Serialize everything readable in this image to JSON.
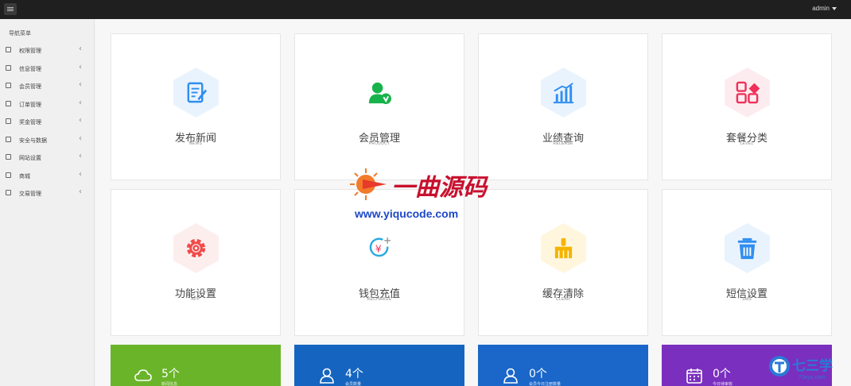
{
  "topbar": {
    "user": "admin"
  },
  "sidebar": {
    "title": "导航菜单",
    "items": [
      {
        "label": "权限管理",
        "icon": "key-icon"
      },
      {
        "label": "信息管理",
        "icon": "key-icon"
      },
      {
        "label": "会员管理",
        "icon": "user-icon"
      },
      {
        "label": "订单管理",
        "icon": "order-icon"
      },
      {
        "label": "奖金管理",
        "icon": "monitor-icon"
      },
      {
        "label": "安全与数据",
        "icon": "monitor-icon"
      },
      {
        "label": "网站设置",
        "icon": "monitor-icon"
      },
      {
        "label": "商城",
        "icon": "shop-icon"
      },
      {
        "label": "交易管理",
        "icon": "grid-icon"
      }
    ]
  },
  "cards": [
    {
      "title": "发布新闻",
      "sub": "NEWS",
      "color": "#2f8ef0",
      "bg": "#e9f3fe",
      "icon": "edit-icon"
    },
    {
      "title": "会员管理",
      "sub": "PRODUCT",
      "color": "#17b34a",
      "bg": "#ffffff",
      "icon": "member-icon"
    },
    {
      "title": "业绩查询",
      "sub": "RELEASE",
      "color": "#2f8ef0",
      "bg": "#e9f3fe",
      "icon": "chart-icon"
    },
    {
      "title": "套餐分类",
      "sub": "LEVEL",
      "color": "#f0305a",
      "bg": "#fdecef",
      "icon": "category-icon"
    },
    {
      "title": "功能设置",
      "sub": "APP",
      "color": "#f04a4a",
      "bg": "#fdeeee",
      "icon": "gear-icon"
    },
    {
      "title": "钱包充值",
      "sub": "RECHARGE",
      "color": "#f0305a",
      "bg": "#ffffff",
      "icon": "wallet-icon"
    },
    {
      "title": "缓存清除",
      "sub": "CLEAR",
      "color": "#f5b400",
      "bg": "#fff6dd",
      "icon": "broom-icon"
    },
    {
      "title": "短信设置",
      "sub": "SMS",
      "color": "#2f8ef0",
      "bg": "#e9f3fe",
      "icon": "trash-icon"
    }
  ],
  "stats": [
    {
      "num": "5个",
      "label": "新闻信息",
      "color": "#6ab42a",
      "icon": "cloud-icon"
    },
    {
      "num": "4个",
      "label": "会员数量",
      "color": "#1565c0",
      "icon": "user-icon"
    },
    {
      "num": "0个",
      "label": "会员今日注册数量",
      "color": "#1a66c9",
      "icon": "user-icon"
    },
    {
      "num": "0个",
      "label": "今日待审核",
      "color": "#7a2fbf",
      "icon": "calendar-icon"
    }
  ],
  "watermark": {
    "text": "一曲源码",
    "url": "www.yiqucode.com"
  },
  "corner_logo": {
    "text": "七三学",
    "sub": "73xyz.com"
  }
}
